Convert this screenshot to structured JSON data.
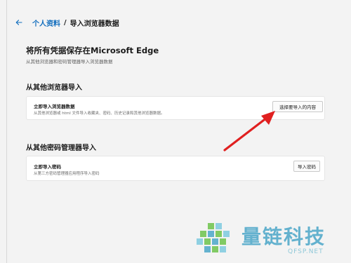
{
  "breadcrumb": {
    "parent": "个人资料",
    "separator": "/",
    "current": "导入浏览器数据"
  },
  "page": {
    "title": "将所有凭据保存在Microsoft Edge",
    "subtitle": "从其他浏览器和密码管理器导入浏览器数据"
  },
  "section_browser": {
    "title": "从其他浏览器导入",
    "card_title": "立即导入浏览器数据",
    "card_desc": "从其他浏览器或 html 文件导入收藏夹、密码、历史记录和其他浏览器数据。",
    "button_label": "选择要导入的内容"
  },
  "section_password": {
    "title": "从其他密码管理器导入",
    "card_title": "立即导入密码",
    "card_desc": "从第三方密码管理器应用程序导入密码",
    "button_label": "导入密码"
  },
  "watermark": {
    "name": "量链科技",
    "url": "QFSP.NET"
  },
  "colors": {
    "accent": "#0f6cbd",
    "arrow": "#e02020",
    "watermark": "#4aa6c8"
  }
}
